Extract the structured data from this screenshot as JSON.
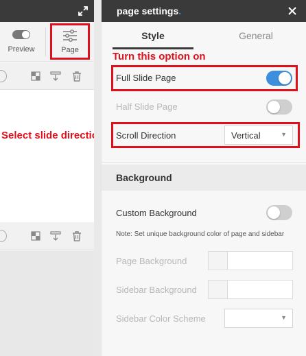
{
  "editor": {
    "toolbar": {
      "preview_label": "Preview",
      "page_label": "Page"
    }
  },
  "annotations": {
    "turn_on": "Turn this option on",
    "select_slide": "Select slide direction"
  },
  "panel": {
    "title": "page settings",
    "title_dot": ".",
    "tabs": [
      {
        "label": "Style",
        "active": true
      },
      {
        "label": "General",
        "active": false
      }
    ],
    "options": {
      "full_slide": {
        "label": "Full Slide Page",
        "enabled": true
      },
      "half_slide": {
        "label": "Half Slide Page",
        "enabled": false
      },
      "scroll_direction": {
        "label": "Scroll Direction",
        "value": "Vertical"
      }
    },
    "background": {
      "title": "Background",
      "custom_background": {
        "label": "Custom Background",
        "enabled": false
      },
      "note": "Note: Set unique background color of page and sidebar",
      "page_background_label": "Page Background",
      "sidebar_background_label": "Sidebar Background",
      "sidebar_color_scheme_label": "Sidebar Color Scheme",
      "sidebar_color_scheme_value": ""
    }
  },
  "colors": {
    "accent_red": "#e0101b",
    "switch_on": "#3d8fde",
    "header_dark": "#3a3a3a"
  }
}
